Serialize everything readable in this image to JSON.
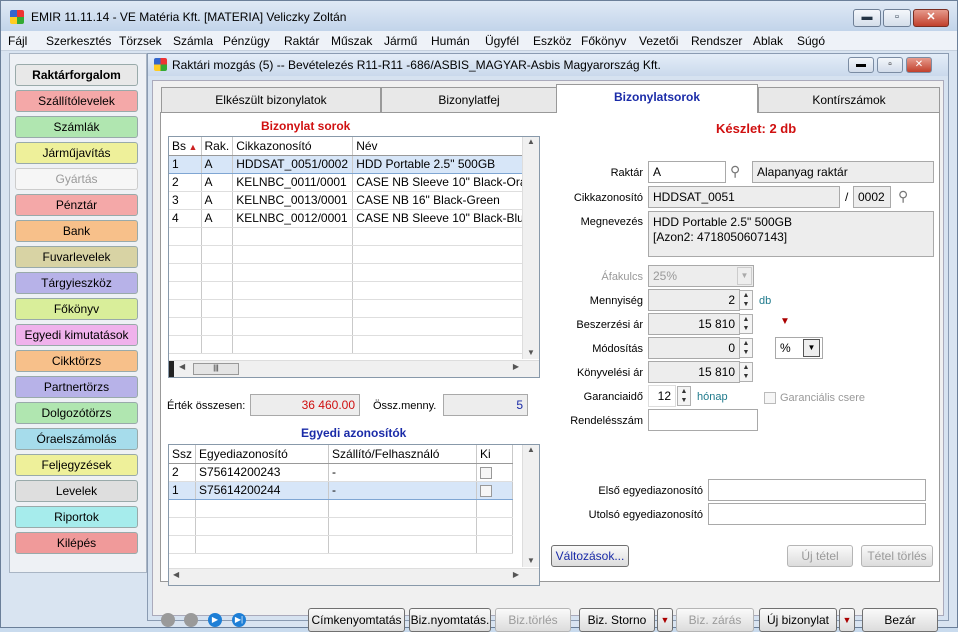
{
  "window": {
    "title": "EMIR 11.11.14 - VE Matéria Kft. [MATERIA] Veliczky Zoltán",
    "min": "▬",
    "max": "▫",
    "close": "✕"
  },
  "menu": [
    "Fájl",
    "Szerkesztés",
    "Törzsek",
    "Számla",
    "Pénzügy",
    "Raktár",
    "Műszak",
    "Jármű",
    "Humán",
    "Ügyfél",
    "Eszköz",
    "Főkönyv",
    "Vezetői",
    "Rendszer",
    "Ablak",
    "Súgó"
  ],
  "sidebar": [
    {
      "label": "Raktárforgalom",
      "color": "#e8e8e8",
      "bold": true
    },
    {
      "label": "Szállítólevelek",
      "color": "#f4a8a8"
    },
    {
      "label": "Számlák",
      "color": "#b0e6b0"
    },
    {
      "label": "Járműjavítás",
      "color": "#eef09a"
    },
    {
      "label": "Gyártás",
      "color": "#f6f6f6",
      "disabled": true
    },
    {
      "label": "Pénztár",
      "color": "#f4a8a8"
    },
    {
      "label": "Bank",
      "color": "#f7c08a"
    },
    {
      "label": "Fuvarlevelek",
      "color": "#d8d3a4"
    },
    {
      "label": "Tárgyieszköz",
      "color": "#b7b2e8"
    },
    {
      "label": "Főkönyv",
      "color": "#d9ee9a"
    },
    {
      "label": "Egyedi kimutatások",
      "color": "#f0b2ec"
    },
    {
      "label": "Cikktörzs",
      "color": "#f7c08a"
    },
    {
      "label": "Partnertörzs",
      "color": "#b7b2e8"
    },
    {
      "label": "Dolgozótörzs",
      "color": "#b0e6b0"
    },
    {
      "label": "Óraelszámolás",
      "color": "#a6dceb"
    },
    {
      "label": "Feljegyzések",
      "color": "#eef09a"
    },
    {
      "label": "Levelek",
      "color": "#dedede"
    },
    {
      "label": "Riportok",
      "color": "#a6ecec"
    },
    {
      "label": "Kilépés",
      "color": "#f09a9a"
    }
  ],
  "mdi": {
    "title": "Raktári mozgás (5) -- Bevételezés R11-R11 -686/ASBIS_MAGYAR-Asbis Magyarország Kft."
  },
  "tabs": [
    "Elkészült bizonylatok",
    "Bizonylatfej",
    "Bizonylatsorok",
    "Kontírszámok"
  ],
  "rows_grid": {
    "title": "Bizonylat sorok",
    "headers": [
      "Bs",
      "Rak.",
      "Cikkazonosító",
      "Név"
    ],
    "rows": [
      [
        "1",
        "A",
        "HDDSAT_0051/0002",
        "HDD Portable 2.5\" 500GB"
      ],
      [
        "2",
        "A",
        "KELNBC_0011/0001",
        "CASE NB Sleeve 10\" Black-Ora"
      ],
      [
        "3",
        "A",
        "KELNBC_0013/0001",
        "CASE NB 16\" Black-Green"
      ],
      [
        "4",
        "A",
        "KELNBC_0012/0001",
        "CASE NB Sleeve 10\" Black-Blu"
      ]
    ]
  },
  "totals": {
    "ertek_label": "Érték összesen:",
    "ertek_value": "36 460.00",
    "menny_label": "Össz.menny.",
    "menny_value": "5"
  },
  "ids_grid": {
    "title": "Egyedi azonosítók",
    "headers": [
      "Ssz",
      "Egyediazonosító",
      "Szállító/Felhasználó",
      "Ki"
    ],
    "rows": [
      [
        "2",
        "S75614200243",
        "-"
      ],
      [
        "1",
        "S75614200244",
        "-"
      ]
    ]
  },
  "form": {
    "keszlet": "Készlet: 2 db",
    "raktar_label": "Raktár",
    "raktar_code": "A",
    "raktar_name": "Alapanyag raktár",
    "cikk_label": "Cikkazonosító",
    "cikk_code": "HDDSAT_0051",
    "cikk_sep": "/",
    "cikk_sub": "0002",
    "megn_label": "Megnevezés",
    "megn_line1": "HDD Portable 2.5\" 500GB",
    "megn_line2": "[Azon2: 4718050607143]",
    "afa_label": "Áfakulcs",
    "afa_value": "25%",
    "menny_label": "Mennyiség",
    "menny_value": "2",
    "menny_unit": "db",
    "beszerz_label": "Beszerzési ár",
    "beszerz_value": "15 810",
    "modos_label": "Módosítás",
    "modos_value": "0",
    "modos_unit": "%",
    "konyv_label": "Könyvelési ár",
    "konyv_value": "15 810",
    "gar_label": "Garanciaidő",
    "gar_value": "12",
    "gar_unit": "hónap",
    "gar_csere": "Garanciális csere",
    "rendeles_label": "Rendelésszám",
    "rendeles_value": "",
    "elso_label": "Első egyediazonosító",
    "elso_value": "",
    "utolso_label": "Utolsó egyediazonosító",
    "utolso_value": ""
  },
  "panel_buttons": {
    "valtozasok": "Változások...",
    "uj_tetel": "Új tétel",
    "tetel_torles": "Tétel törlés"
  },
  "bottom_buttons": {
    "cimke": "Címkenyomtatás",
    "biznyomt": "Biz.nyomtatás.",
    "biztorles": "Biz.törlés",
    "storno": "Biz. Storno",
    "zaras": "Biz. zárás",
    "uj": "Új bizonylat",
    "bezar": "Bezár"
  }
}
